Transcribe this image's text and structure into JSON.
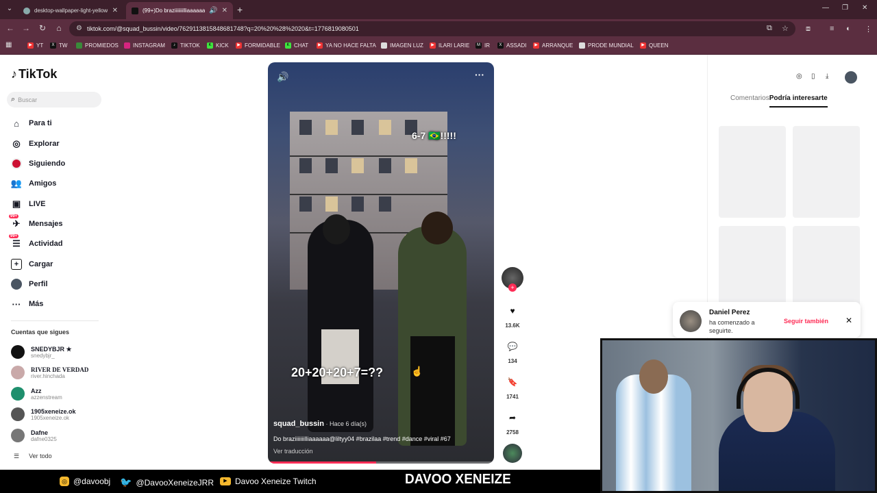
{
  "browser": {
    "tabs": [
      {
        "title": "desktop-wallpaper-light-yellow",
        "active": false
      },
      {
        "title": "(99+)Do braziiiiiiilliaaaaaa@l",
        "active": true
      }
    ],
    "url": "tiktok.com/@squad_bussin/video/7629113815848681748?q=20%20%28%2020&t=1776819080501",
    "bookmarks": [
      "YT",
      "TW",
      "PROMIEDOS",
      "INSTAGRAM",
      "TIKTOK",
      "KICK",
      "FORMIDABLE",
      "CHAT",
      "YA NO HACE FALTA",
      "IMAGEN LUZ",
      "ILARI LARIE",
      "IR",
      "ASSADI",
      "ARRANQUE",
      "PRODE MUNDIAL",
      "QUEEN"
    ]
  },
  "sidebar": {
    "logo": "TikTok",
    "search_placeholder": "Buscar",
    "nav": [
      {
        "label": "Para ti",
        "icon": "home-icon"
      },
      {
        "label": "Explorar",
        "icon": "compass-icon"
      },
      {
        "label": "Siguiendo",
        "icon": "following-avatar-icon"
      },
      {
        "label": "Amigos",
        "icon": "friends-icon"
      },
      {
        "label": "LIVE",
        "icon": "live-icon"
      },
      {
        "label": "Mensajes",
        "icon": "messages-icon",
        "badge": "99+"
      },
      {
        "label": "Actividad",
        "icon": "activity-icon",
        "badge": "99+"
      },
      {
        "label": "Cargar",
        "icon": "upload-icon"
      },
      {
        "label": "Perfil",
        "icon": "profile-avatar-icon"
      },
      {
        "label": "Más",
        "icon": "more-dots-icon"
      }
    ],
    "following_title": "Cuentas que sigues",
    "accounts": [
      {
        "name": "SNEDYBJR ★",
        "handle": "snedybjr_",
        "color": "#111"
      },
      {
        "name": "RIVER DE VERDAD",
        "handle": "river.hinchada",
        "color": "#c9a9a9"
      },
      {
        "name": "Azz",
        "handle": "azzenstream",
        "color": "#1e8f6d"
      },
      {
        "name": "1905xeneize.ok",
        "handle": "1905xeneize.ok",
        "color": "#555"
      },
      {
        "name": "Dafne",
        "handle": "dafne0325",
        "color": "#777"
      }
    ],
    "see_all": "Ver todo"
  },
  "video": {
    "overlay_top": "6-7 🇧🇷!!!!!",
    "overlay_bottom": "20+20+20+7=??",
    "author": "squad_bussin",
    "time_ago": " · Hace 6 día(s)",
    "description": "Do braziiiiiiilliaaaaaa@liltyy04 #brazilaa #trend #dance #viral #67",
    "translate": "Ver traducción",
    "progress": 0.48
  },
  "actions": {
    "likes": "13.6K",
    "comments": "134",
    "saves": "1741",
    "shares": "2758"
  },
  "right_panel": {
    "tabs": [
      "Comentarios",
      "Podría interesarte"
    ],
    "active_tab": 1
  },
  "notification": {
    "name": "Daniel Perez",
    "text": "ha comenzado a seguirte.",
    "action": "Seguir también"
  },
  "footer": {
    "instagram": "@davoobj",
    "twitter": "@DavooXeneizeJRR",
    "twitch": "Davoo Xeneize Twitch",
    "brand": "DAVOO XENEIZE"
  }
}
